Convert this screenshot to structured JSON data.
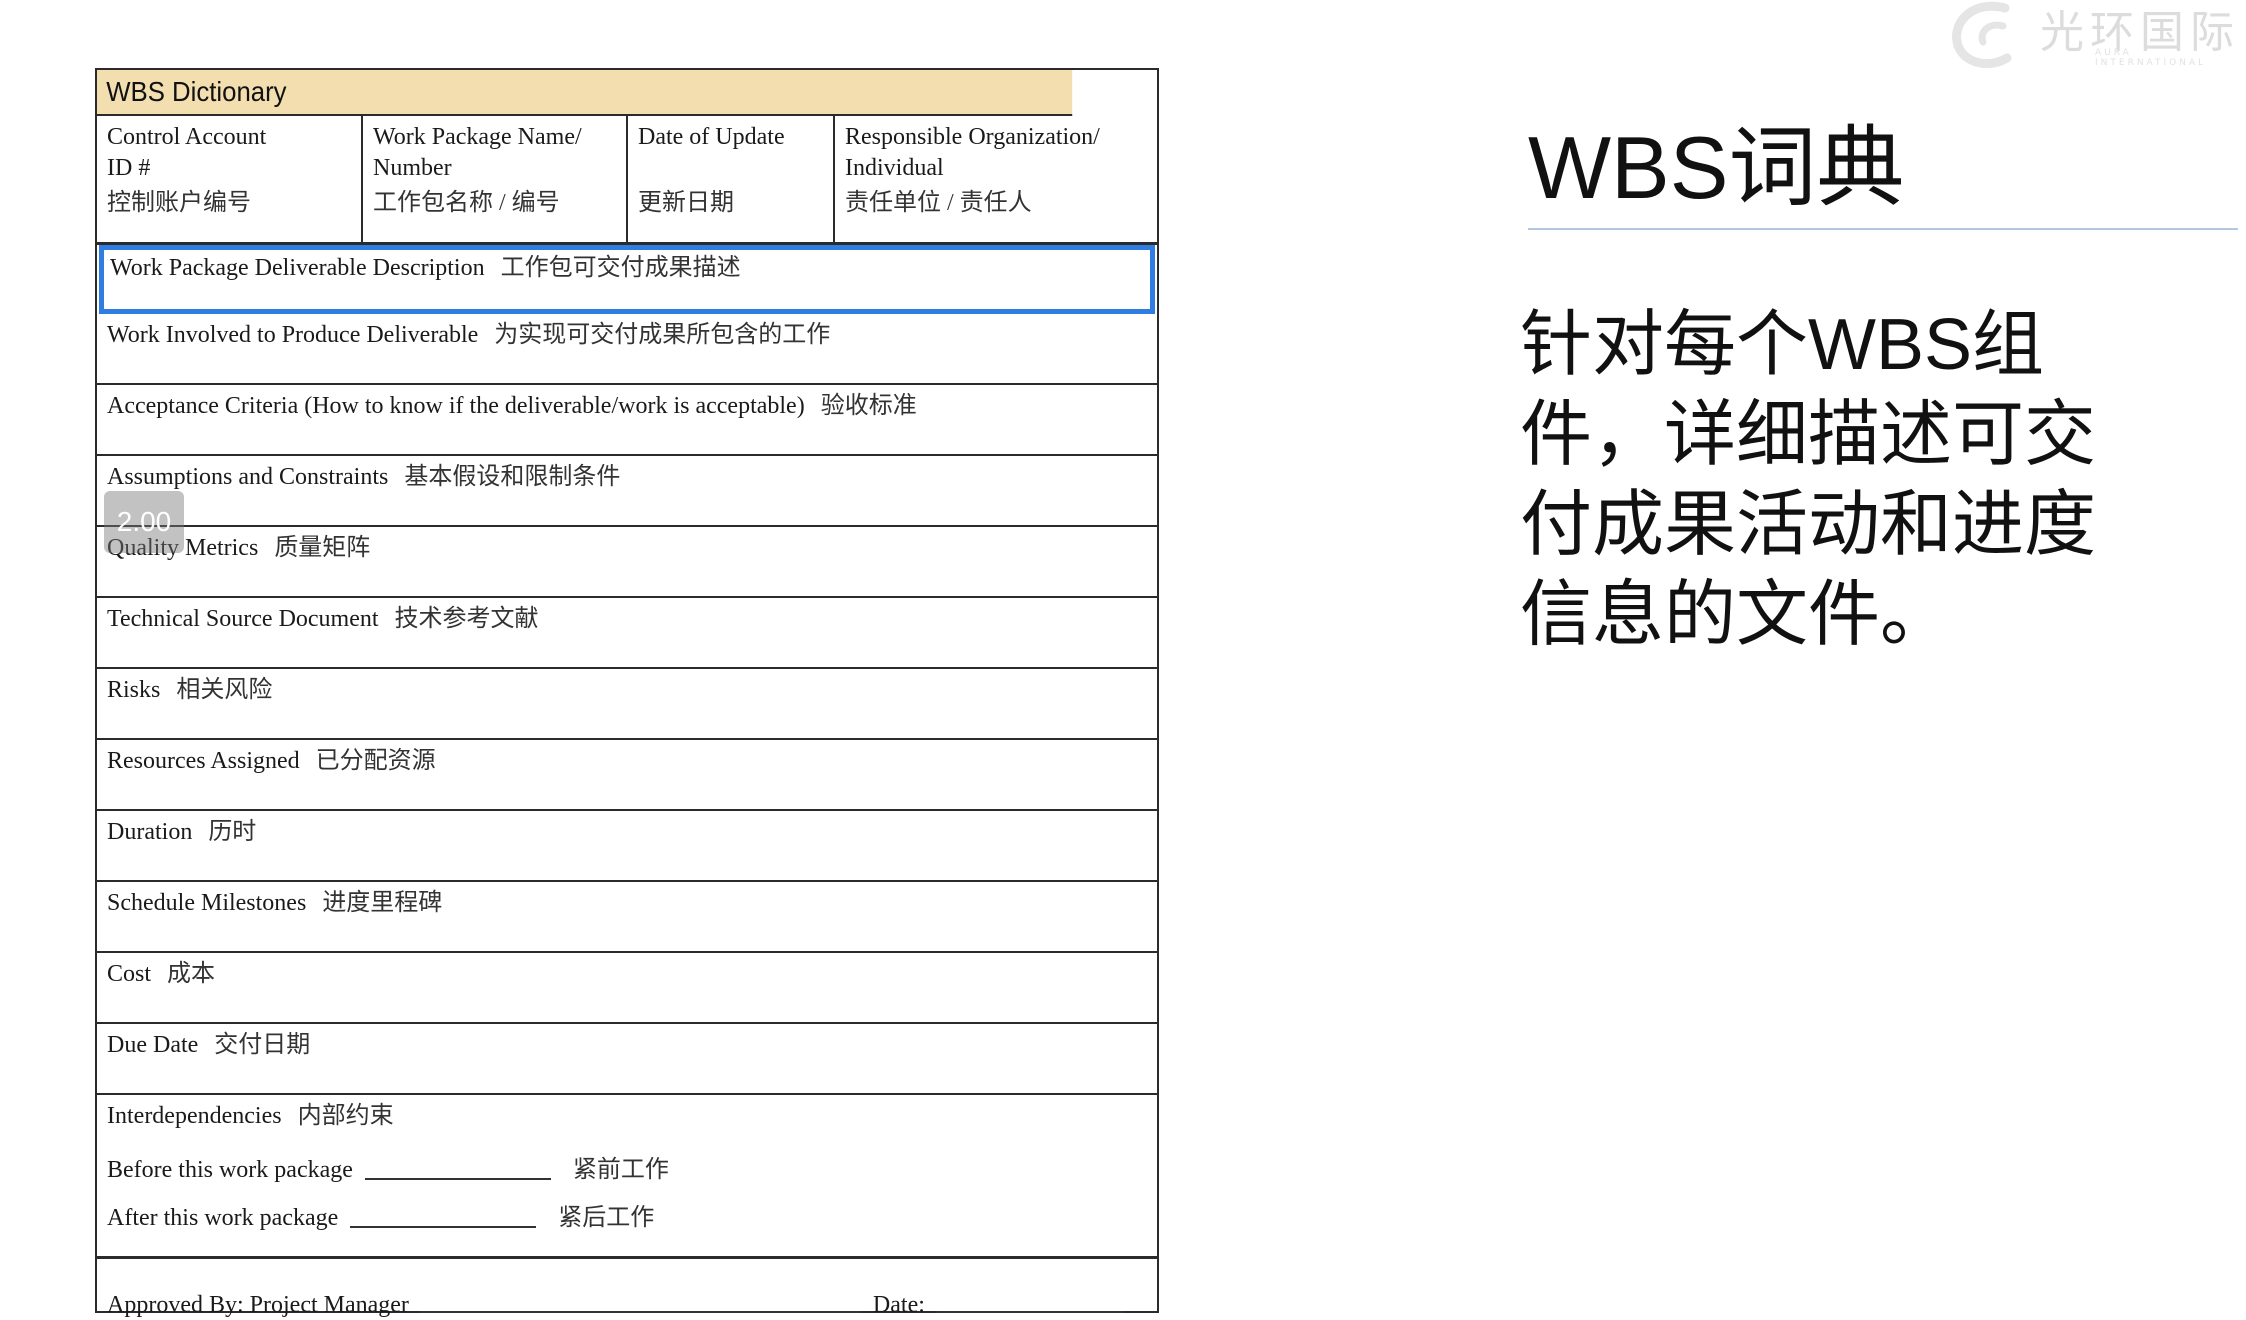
{
  "form": {
    "title": "WBS Dictionary",
    "header": [
      {
        "en": "Control Account\nID #",
        "cn": "控制账户编号"
      },
      {
        "en": "Work Package Name/\nNumber",
        "cn": "工作包名称 / 编号"
      },
      {
        "en": "Date of Update",
        "cn": "更新日期"
      },
      {
        "en": "Responsible Organization/\nIndividual",
        "cn": "责任单位 / 责任人"
      }
    ],
    "rows": [
      {
        "en": "Work Package Deliverable Description",
        "cn": "工作包可交付成果描述"
      },
      {
        "en": "Work Involved to Produce Deliverable",
        "cn": "为实现可交付成果所包含的工作"
      },
      {
        "en": "Acceptance Criteria (How to know if the deliverable/work is acceptable)",
        "cn": "验收标准"
      },
      {
        "en": "Assumptions and Constraints",
        "cn": "基本假设和限制条件"
      },
      {
        "en": "Quality Metrics",
        "cn": "质量矩阵"
      },
      {
        "en": "Technical Source Document",
        "cn": "技术参考文献"
      },
      {
        "en": "Risks",
        "cn": "相关风险"
      },
      {
        "en": "Resources Assigned",
        "cn": "已分配资源"
      },
      {
        "en": "Duration",
        "cn": "历时"
      },
      {
        "en": "Schedule Milestones",
        "cn": "进度里程碑"
      },
      {
        "en": "Cost",
        "cn": "成本"
      },
      {
        "en": "Due Date",
        "cn": "交付日期"
      }
    ],
    "interdependencies": {
      "en": "Interdependencies",
      "cn": "内部约束",
      "before_en": "Before this work package",
      "before_cn": "紧前工作",
      "after_en": "After this work package",
      "after_cn": "紧后工作"
    },
    "approved_by": "Approved By:  Project Manager",
    "date_label": "Date:"
  },
  "speed_badge": "2.00",
  "slide": {
    "title": "WBS词典",
    "body": "针对每个WBS组件，详细描述可交付成果活动和进度信息的文件。"
  },
  "logo": {
    "name": "光环国际",
    "subtitle": "AURA INTERNATIONAL"
  },
  "colors": {
    "title_band": "#f2deaf",
    "selection": "#2f7de1",
    "rule": "#b4c7e0"
  }
}
